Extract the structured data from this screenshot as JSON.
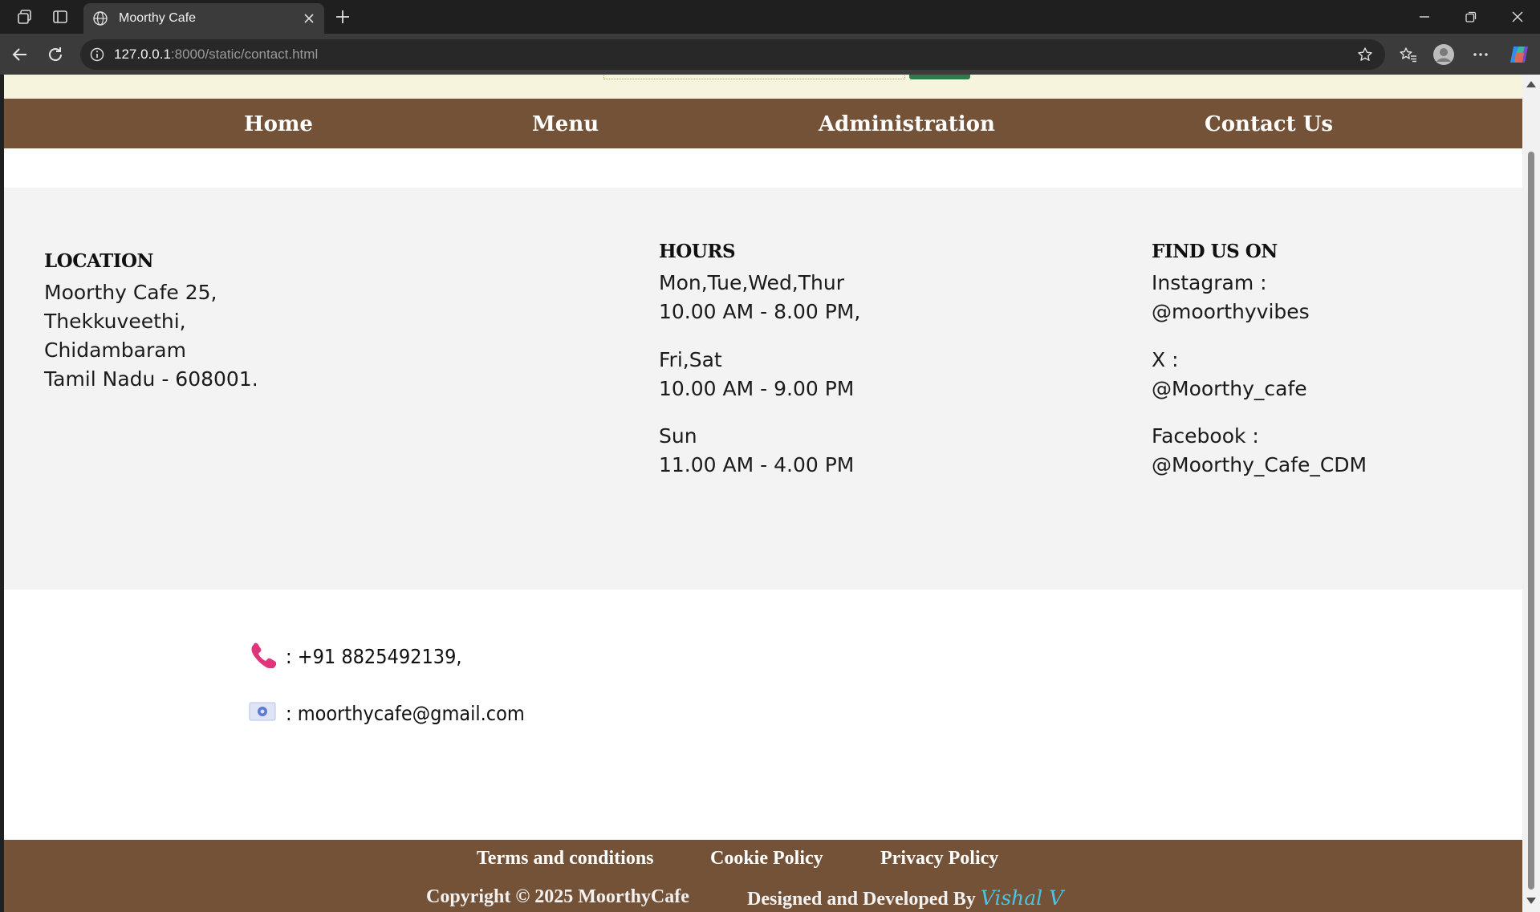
{
  "browser": {
    "tab_title": "Moorthy Cafe",
    "url_host": "127.0.0.1",
    "url_rest": ":8000/static/contact.html"
  },
  "site_nav": {
    "items": [
      "Home",
      "Menu",
      "Administration",
      "Contact Us"
    ]
  },
  "location": {
    "title": "LOCATION",
    "lines": [
      "Moorthy Cafe 25,",
      "Thekkuveethi,",
      "Chidambaram",
      "Tamil Nadu - 608001."
    ]
  },
  "hours": {
    "title": "HOURS",
    "groups": [
      {
        "days": "Mon,Tue,Wed,Thur",
        "time": "10.00 AM - 8.00 PM,"
      },
      {
        "days": "Fri,Sat",
        "time": "10.00 AM - 9.00 PM"
      },
      {
        "days": "Sun",
        "time": "11.00 AM - 4.00 PM"
      }
    ]
  },
  "find_us": {
    "title": "FIND US ON",
    "items": [
      {
        "label": "Instagram :",
        "handle": "@moorthyvibes"
      },
      {
        "label": "X :",
        "handle": "@Moorthy_cafe"
      },
      {
        "label": "Facebook :",
        "handle": "@Moorthy_Cafe_CDM"
      }
    ]
  },
  "contact": {
    "phone": ": +91 8825492139,",
    "email": ": moorthycafe@gmail.com",
    "phone_icon_color": "#e0357a",
    "email_icon_color": "#5b7bd6"
  },
  "footer": {
    "links": [
      "Terms and conditions",
      "Cookie Policy",
      "Privacy Policy"
    ],
    "copyright": "Copyright © 2025 MoorthyCafe",
    "designed_by": "Designed and Developed By",
    "designer": "Vishal V"
  },
  "colors": {
    "brand_brown": "#745237",
    "info_band": "#f3f3f3",
    "top_strip": "#f6f4dc"
  }
}
